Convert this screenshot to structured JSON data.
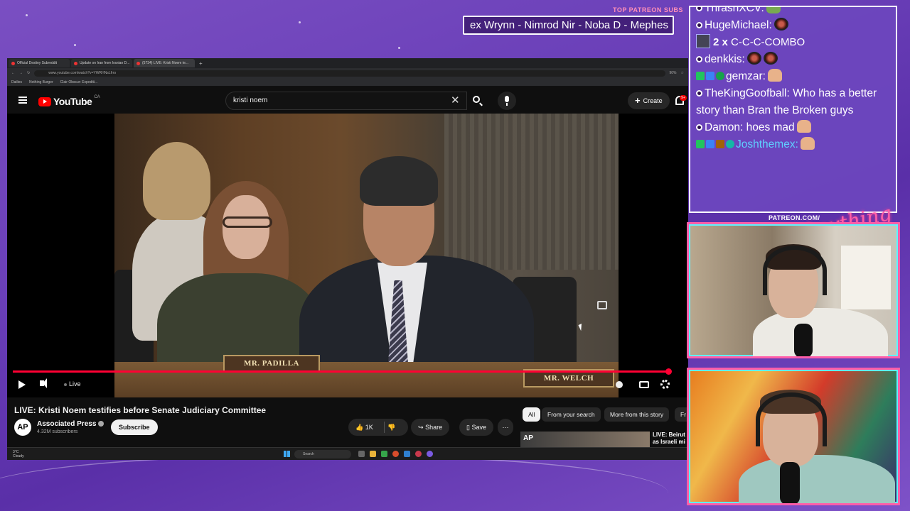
{
  "patreon": {
    "subs_label": "TOP PATREON SUBS",
    "ticker_text": "ex Wrynn - Nimrod Nir - Noba D - Mephes",
    "url": "PATREON.COM/",
    "script_logo": "Anything Else"
  },
  "browser": {
    "tabs": [
      {
        "title": "Official Destiny Subreddit"
      },
      {
        "title": "Update on Iran from Iranian D..."
      },
      {
        "title": "(5734) LIVE: Kristi Noem te..."
      }
    ],
    "address": "www.youtube.com/watch?v=YWRHNsLfrro",
    "zoom": "90%",
    "bookmarks": [
      "Dailies",
      "Nothing Burger",
      "Clair Obscur: Expediti..."
    ]
  },
  "youtube": {
    "logo_text": "YouTube",
    "country_code": "CA",
    "search_query": "kristi noem",
    "create_label": "Create",
    "notification_count": "9+",
    "video": {
      "nameplate_left": "MR. PADILLA",
      "nameplate_right": "MR. WELCH",
      "live_label": "Live",
      "progress": 1.0
    },
    "title": "LIVE: Kristi Noem testifies before Senate Judiciary Committee",
    "channel": {
      "avatar_text": "AP",
      "name": "Associated Press",
      "subscribers": "4.32M subscribers",
      "subscribe_label": "Subscribe"
    },
    "actions": {
      "likes": "1K",
      "share": "Share",
      "save": "Save"
    },
    "chips": [
      "All",
      "From your search",
      "More from this story",
      "Fr"
    ],
    "recommendation": {
      "thumb_text": "AP",
      "title_line1": "LIVE: Beirut",
      "title_line2": "as Israeli mi"
    }
  },
  "taskbar": {
    "temp": "3°C",
    "weather": "Cloudy",
    "search": "Search"
  },
  "chat": [
    {
      "name": "ThrashXCV:",
      "emote": "pepe",
      "top_cut": true
    },
    {
      "name": "HugeMichael:",
      "emote": "red"
    },
    {
      "type": "combo",
      "count": "2 x",
      "text": "C-C-C-COMBO"
    },
    {
      "name": "denkkis:",
      "emote": "red2"
    },
    {
      "name": "gemzar:",
      "emote": "skin",
      "badges": true
    },
    {
      "name": "TheKingGoofball:",
      "message": "Who has a better story than Bran the Broken guys"
    },
    {
      "name": "Damon:",
      "message": "hoes mad",
      "emote": "skin"
    },
    {
      "name": "Joshthemex:",
      "emote": "skin",
      "badges": true,
      "color": "#5fd0ff"
    }
  ]
}
